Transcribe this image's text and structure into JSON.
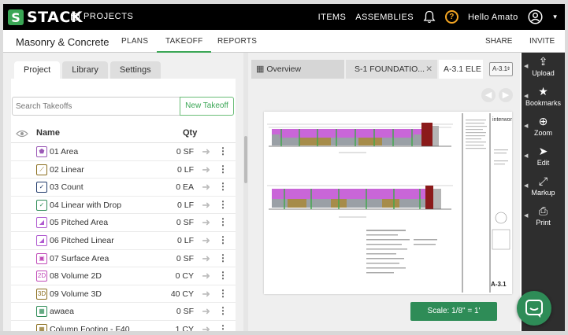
{
  "header": {
    "logo_text": "STACK",
    "logo_mark": "S",
    "projects_label": "PROJECTS",
    "items_label": "ITEMS",
    "assemblies_label": "ASSEMBLIES",
    "help_glyph": "?",
    "user_greeting": "Hello Amato"
  },
  "subnav": {
    "project_name": "Masonry & Concrete",
    "tabs": [
      {
        "label": "PLANS",
        "active": false
      },
      {
        "label": "TAKEOFF",
        "active": true
      },
      {
        "label": "REPORTS",
        "active": false
      }
    ],
    "share_label": "SHARE",
    "invite_label": "INVITE"
  },
  "panel": {
    "tabs": [
      {
        "label": "Project",
        "active": true
      },
      {
        "label": "Library",
        "active": false
      },
      {
        "label": "Settings",
        "active": false
      }
    ],
    "search_placeholder": "Search Takeoffs",
    "new_takeoff_label": "New Takeoff",
    "col_name": "Name",
    "col_qty": "Qty",
    "rows": [
      {
        "name": "01 Area",
        "qty": "0 SF",
        "icon": "area-icon",
        "color": "#9b59b6",
        "glyph": "⬟"
      },
      {
        "name": "02 Linear",
        "qty": "0 LF",
        "icon": "linear-icon",
        "color": "#8a6d1c",
        "glyph": "⟋"
      },
      {
        "name": "03 Count",
        "qty": "0 EA",
        "icon": "count-icon",
        "color": "#1f3a6b",
        "glyph": "✓"
      },
      {
        "name": "04 Linear with Drop",
        "qty": "0 LF",
        "icon": "linear-drop-icon",
        "color": "#2e8c57",
        "glyph": "✓"
      },
      {
        "name": "05 Pitched Area",
        "qty": "0 SF",
        "icon": "pitched-area-icon",
        "color": "#b05ad0",
        "glyph": "◢"
      },
      {
        "name": "06 Pitched Linear",
        "qty": "0 LF",
        "icon": "pitched-linear-icon",
        "color": "#b05ad0",
        "glyph": "◢"
      },
      {
        "name": "07 Surface Area",
        "qty": "0 SF",
        "icon": "surface-area-icon",
        "color": "#c04ab8",
        "glyph": "▣"
      },
      {
        "name": "08 Volume 2D",
        "qty": "0 CY",
        "icon": "volume-2d-icon",
        "color": "#c04ab8",
        "glyph": "2D"
      },
      {
        "name": "09 Volume 3D",
        "qty": "40 CY",
        "icon": "volume-3d-icon",
        "color": "#8a6d1c",
        "glyph": "3D"
      },
      {
        "name": "awaea",
        "qty": "0 SF",
        "icon": "area-icon",
        "color": "#2e8c57",
        "glyph": "▦"
      },
      {
        "name": "Column Footing - F40",
        "qty": "1 CY",
        "icon": "footing-icon",
        "color": "#8a6d1c",
        "glyph": "▦"
      }
    ]
  },
  "doc": {
    "tabs": [
      {
        "label": "Overview",
        "active": false
      },
      {
        "label": "S-1 FOUNDATIO...",
        "active": false
      },
      {
        "label": "A-3.1 ELE",
        "active": true
      }
    ],
    "close_glyph": "✕",
    "sheet_select": "A-3.1",
    "scale_label": "Scale: 1/8\" = 1'",
    "sheet_title_block": "A-3.1",
    "title_block_firm": "interwork"
  },
  "tools": [
    {
      "label": "Upload",
      "icon": "upload-icon",
      "glyph": "⇪"
    },
    {
      "label": "Bookmarks",
      "icon": "bookmark-star-icon",
      "glyph": "★"
    },
    {
      "label": "Zoom",
      "icon": "zoom-icon",
      "glyph": "⊕"
    },
    {
      "label": "Edit",
      "icon": "cursor-icon",
      "glyph": "➤"
    },
    {
      "label": "Markup",
      "icon": "markup-icon",
      "glyph": "⤢"
    },
    {
      "label": "Print",
      "icon": "printer-icon",
      "glyph": "⎙"
    }
  ],
  "colors": {
    "brand_green": "#3aa655",
    "scale_green": "#2e8c57",
    "help_orange": "#f5a623",
    "header_bg": "#000000",
    "toolbar_bg": "#2e2e2e"
  }
}
